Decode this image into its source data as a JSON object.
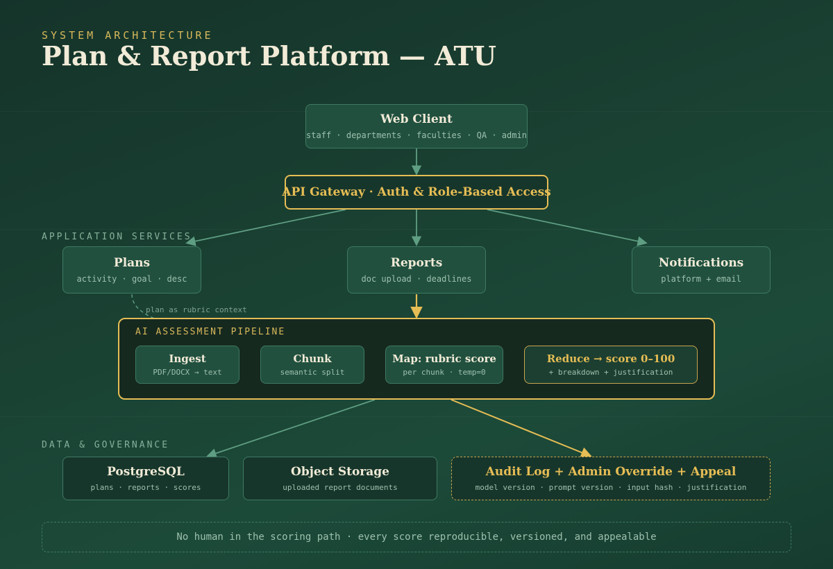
{
  "header": {
    "kicker": "SYSTEM ARCHITECTURE",
    "title": "Plan & Report Platform — ATU"
  },
  "client": {
    "name": "Web Client",
    "sub": "staff · departments · faculties · QA · admin"
  },
  "gateway": {
    "name": "API Gateway · Auth & Role-Based Access"
  },
  "sections": {
    "application": "APPLICATION SERVICES",
    "data": "DATA & GOVERNANCE"
  },
  "services": {
    "plans": {
      "name": "Plans",
      "sub": "activity · goal · desc"
    },
    "reports": {
      "name": "Reports",
      "sub": "doc upload · deadlines"
    },
    "notifications": {
      "name": "Notifications",
      "sub": "platform + email"
    }
  },
  "context_label": "plan as rubric context",
  "pipeline": {
    "label": "AI ASSESSMENT PIPELINE",
    "ingest": {
      "name": "Ingest",
      "sub": "PDF/DOCX → text"
    },
    "chunk": {
      "name": "Chunk",
      "sub": "semantic split"
    },
    "map": {
      "name": "Map: rubric score",
      "sub": "per chunk · temp=0"
    },
    "reduce": {
      "name": "Reduce → score 0–100",
      "sub": "+ breakdown + justification"
    }
  },
  "data_layer": {
    "postgres": {
      "name": "PostgreSQL",
      "sub": "plans · reports · scores"
    },
    "storage": {
      "name": "Object Storage",
      "sub": "uploaded report documents"
    },
    "audit": {
      "name": "Audit Log + Admin Override + Appeal",
      "sub": "model version · prompt version · input hash · justification"
    }
  },
  "footer": "No human in the scoring path · every score reproducible, versioned, and appealable",
  "colors": {
    "accent_gold": "#e6bd55",
    "node_green": "#21503f",
    "edge_green": "#5f9e83",
    "background": "#1a4233"
  }
}
